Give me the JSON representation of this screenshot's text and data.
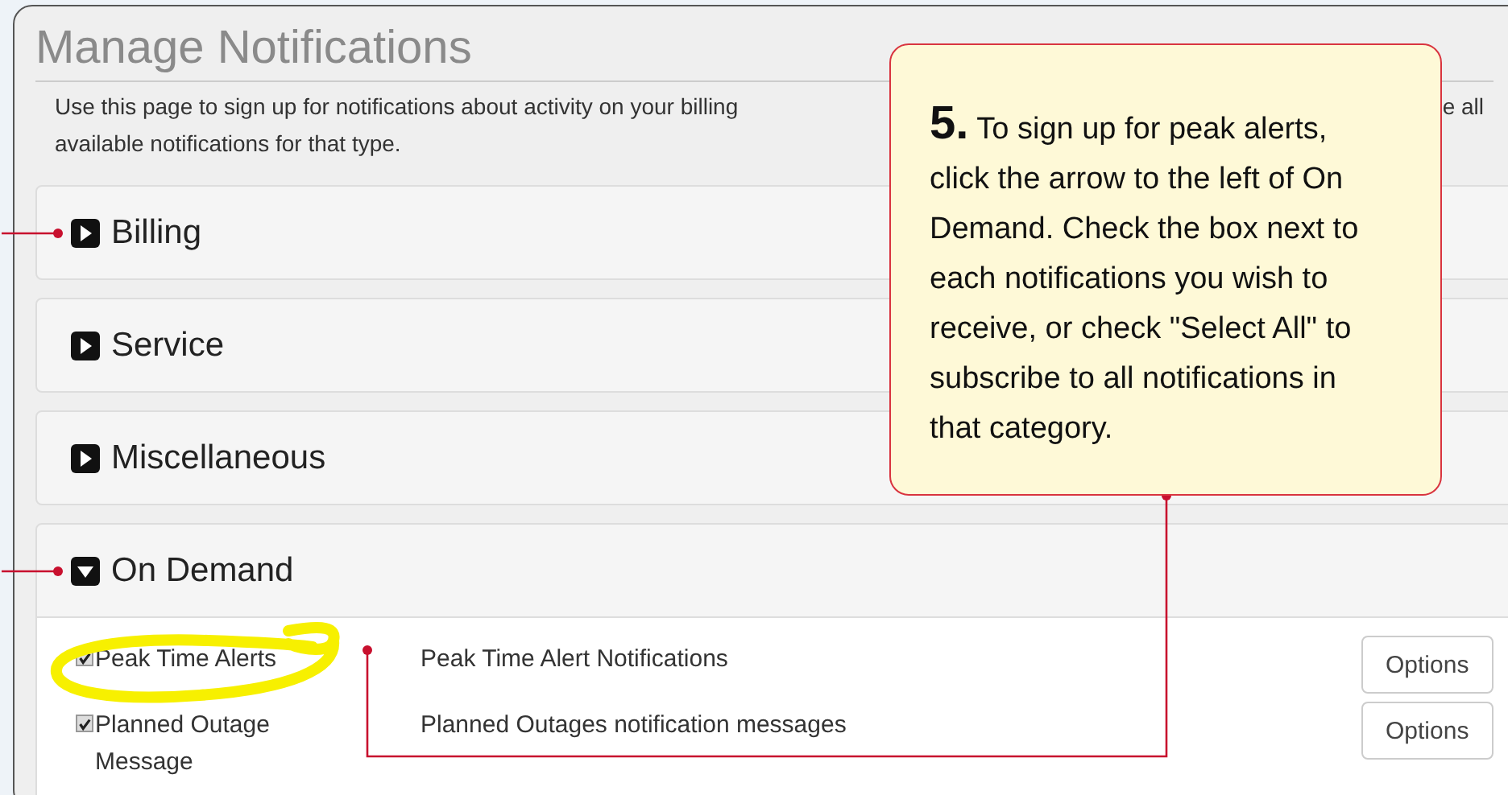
{
  "page": {
    "title": "Manage Notifications",
    "description_line_1": "Use this page to sign up for notifications about activity on your billing",
    "description_line_1_end": "e all",
    "description_line_2": "available notifications for that type."
  },
  "sections": [
    {
      "label": "Billing",
      "expanded": false,
      "pointer": true
    },
    {
      "label": "Service",
      "expanded": false,
      "pointer": false
    },
    {
      "label": "Miscellaneous",
      "expanded": false,
      "pointer": false
    },
    {
      "label": "On Demand",
      "expanded": true,
      "pointer": true,
      "notifications": [
        {
          "name": "Peak Time Alerts",
          "checked": true,
          "description": "Peak Time Alert Notifications",
          "button": "Options",
          "highlighted": true
        },
        {
          "name": "Planned Outage Message",
          "checked": true,
          "description": "Planned Outages notification messages",
          "button": "Options",
          "highlighted": false
        }
      ]
    }
  ],
  "callout": {
    "step": "5.",
    "text": "To sign up for peak alerts, click the arrow to the left of On Demand. Check the box next to each notifications you wish to receive, or check \"Select All\" to subscribe to all notifications in that category."
  }
}
